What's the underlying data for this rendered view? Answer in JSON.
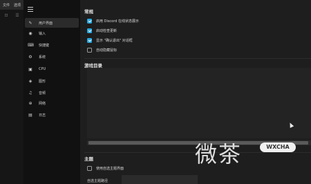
{
  "menubar": {
    "items": [
      "文件",
      "选项"
    ]
  },
  "strip": {
    "btn1": "⊡",
    "btn2": "☰"
  },
  "sidebar": {
    "items": [
      {
        "label": "用户界面",
        "icon": "brush-icon",
        "glyph": "✎",
        "active": true
      },
      {
        "label": "输入",
        "icon": "eye-icon",
        "glyph": "◉",
        "active": false
      },
      {
        "label": "快捷键",
        "icon": "keyboard-icon",
        "glyph": "⌨",
        "active": false
      },
      {
        "label": "系统",
        "icon": "gear-icon",
        "glyph": "⚙",
        "active": false
      },
      {
        "label": "CPU",
        "icon": "cpu-icon",
        "glyph": "▣",
        "active": false
      },
      {
        "label": "图形",
        "icon": "graphics-icon",
        "glyph": "◈",
        "active": false
      },
      {
        "label": "音频",
        "icon": "music-icon",
        "glyph": "♫",
        "active": false
      },
      {
        "label": "网络",
        "icon": "plus-circle-icon",
        "glyph": "⊕",
        "active": false
      },
      {
        "label": "日志",
        "icon": "document-icon",
        "glyph": "▤",
        "active": false
      }
    ]
  },
  "general": {
    "title": "常规",
    "options": [
      {
        "label": "启用 Discord 在线状态展示",
        "checked": true
      },
      {
        "label": "启动检查更新",
        "checked": true
      },
      {
        "label": "显示 \"确认退出\" 对话框",
        "checked": true
      },
      {
        "label": "自动隐藏鼠标",
        "checked": false
      }
    ]
  },
  "game_dirs": {
    "title": "游戏目录"
  },
  "theme": {
    "title": "主题",
    "custom_theme_label": "使用自选主题界面",
    "custom_theme_checked": false,
    "path_label": "自选主题路径",
    "path_value": ""
  },
  "watermark": {
    "text": "微茶",
    "badge": "WXCHA"
  },
  "colors": {
    "accent": "#27a8e0",
    "background": "#1e1e1e",
    "sidebar": "#111111"
  }
}
